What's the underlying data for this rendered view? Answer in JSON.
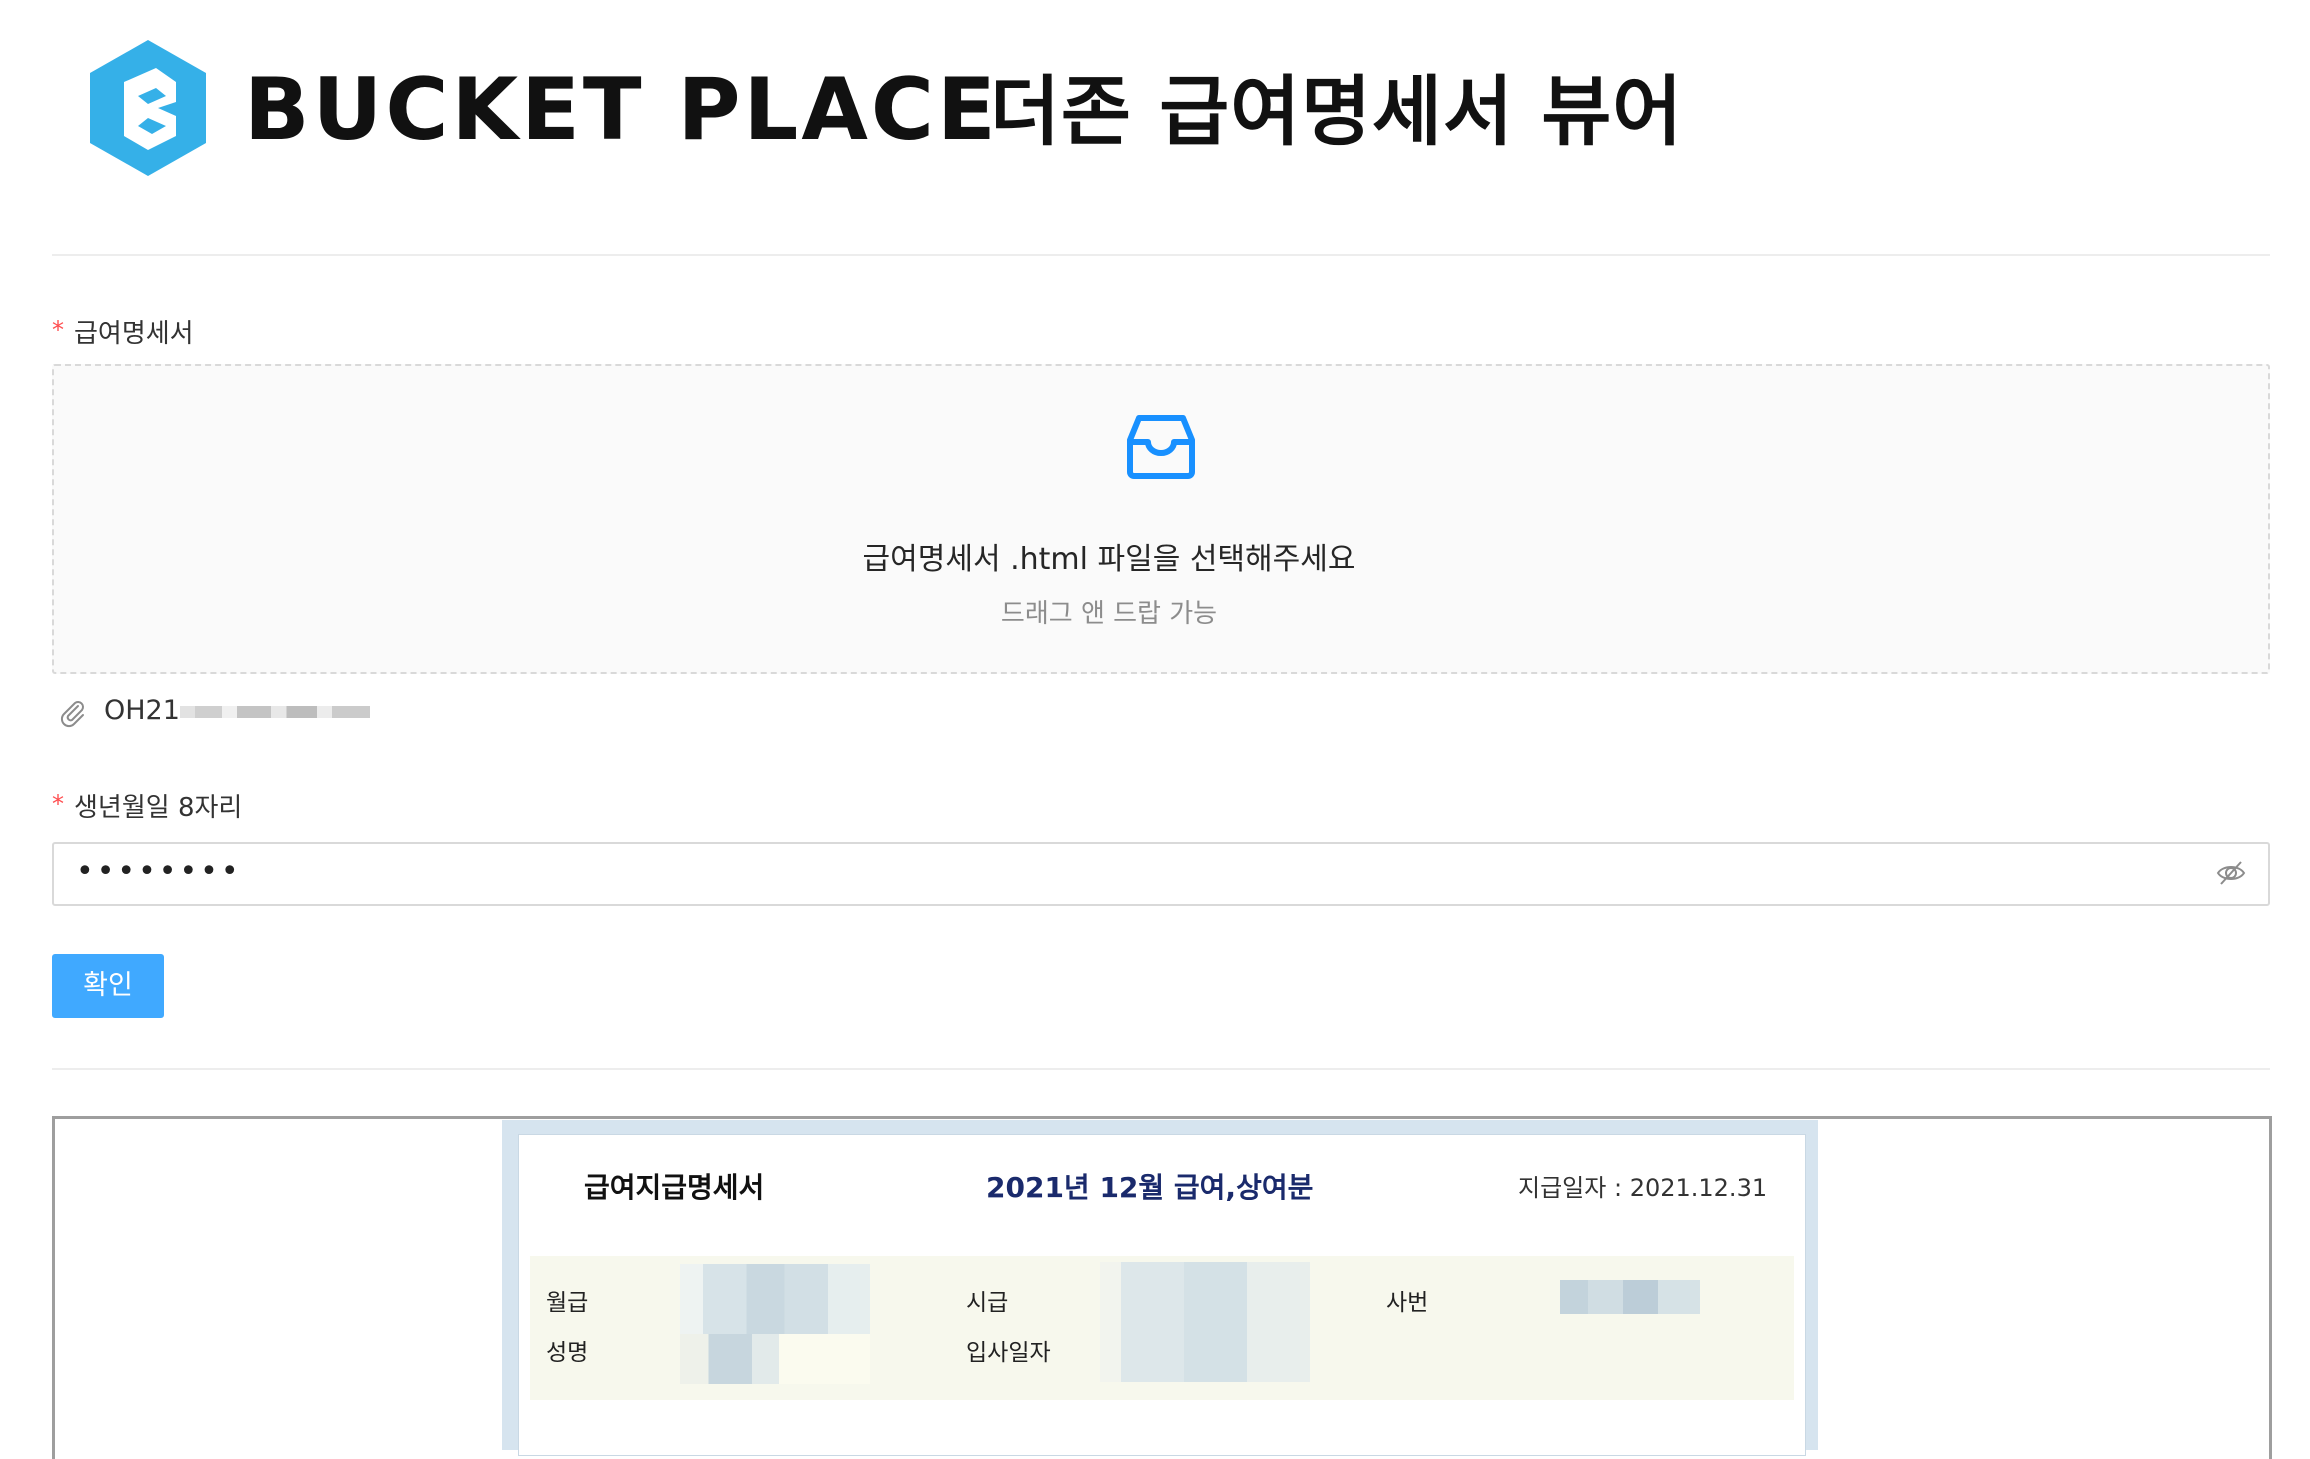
{
  "header": {
    "brand": "BUCKET PLACE",
    "app_title": "더존 급여명세서 뷰어",
    "logo_icon": "bucketplace-hexagon-logo",
    "brand_color": "#3AB1E6"
  },
  "form": {
    "payslip_label": "급여명세서",
    "upload": {
      "icon": "inbox-icon",
      "text": "급여명세서 .html 파일을 선택해주세요",
      "hint": "드래그 앤 드랍 가능"
    },
    "attached_file": {
      "icon": "paperclip-icon",
      "name_visible": "OH21"
    },
    "birthdate_label": "생년월일 8자리",
    "birthdate_value_masked": "••••••••",
    "visibility_icon": "eye-invisible-icon",
    "confirm_label": "확인",
    "required_mark": "*",
    "accent_color": "#40A9FF",
    "required_color": "#FF4D4F"
  },
  "preview": {
    "title": "급여지급명세서",
    "period": "2021년 12월 급여,상여분",
    "pay_date_label": "지급일자 :",
    "pay_date": "2021.12.31",
    "fields": {
      "monthly_pay": "월급",
      "hourly_pay": "시급",
      "employee_no": "사번",
      "name": "성명",
      "hire_date": "입사일자"
    }
  }
}
